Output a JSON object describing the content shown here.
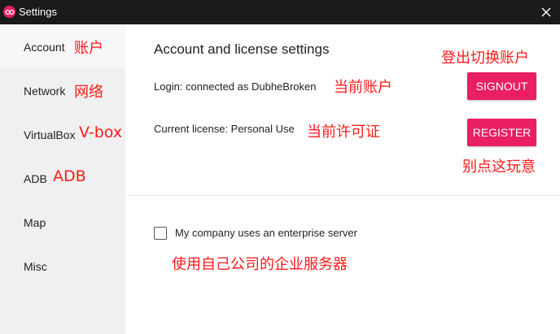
{
  "window": {
    "title": "Settings",
    "app_icon": "infinity-logo-icon",
    "close_icon": "close-icon"
  },
  "sidebar": {
    "items": [
      {
        "label": "Account",
        "annotation": "账户",
        "active": true
      },
      {
        "label": "Network",
        "annotation": "网络"
      },
      {
        "label": "VirtualBox",
        "annotation": "V-box"
      },
      {
        "label": "ADB",
        "annotation": "ADB"
      },
      {
        "label": "Map",
        "annotation": ""
      },
      {
        "label": "Misc",
        "annotation": ""
      }
    ]
  },
  "main": {
    "section_title": "Account and license settings",
    "login_text": "Login: connected as DubheBroken",
    "login_annotation": "当前账户",
    "license_text": "Current license: Personal Use",
    "license_annotation": "当前许可证",
    "signout_label": "SIGNOUT",
    "signout_annotation": "登出切换账户",
    "register_label": "REGISTER",
    "register_annotation": "别点这玩意",
    "enterprise_checkbox_label": "My company uses an enterprise server",
    "enterprise_checked": false,
    "enterprise_annotation": "使用自己公司的企业服务器"
  },
  "colors": {
    "accent": "#e91e63",
    "titlebar": "#1a1a1a",
    "sidebar_bg": "#f0f0f0",
    "annotation": "#ff1a1a"
  }
}
